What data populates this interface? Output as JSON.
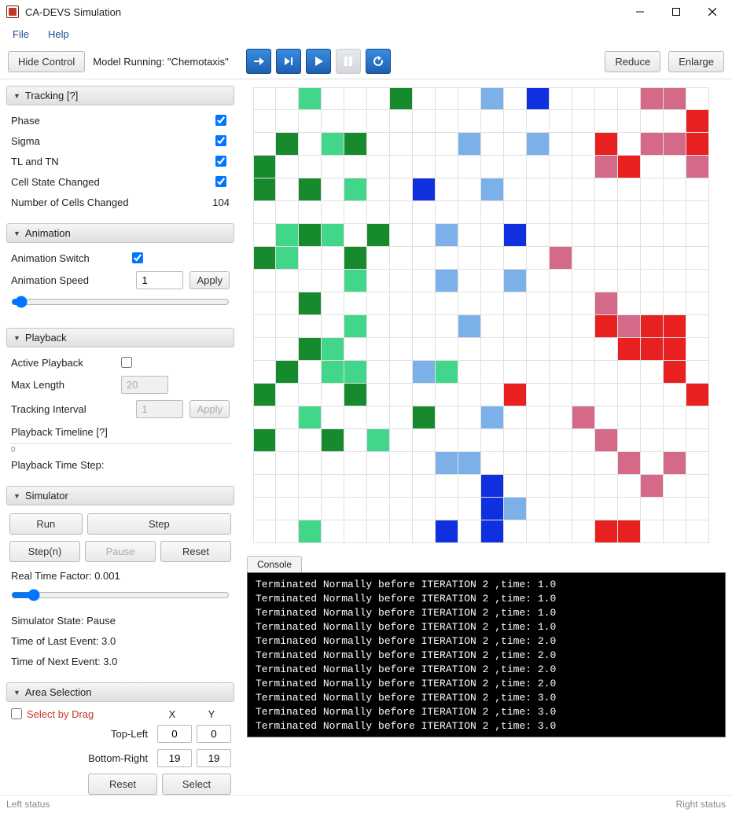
{
  "window": {
    "title": "CA-DEVS Simulation"
  },
  "menu": {
    "file": "File",
    "help": "Help"
  },
  "toolbar": {
    "hide_control": "Hide Control",
    "running_label": "Model Running: \"Chemotaxis\"",
    "reduce": "Reduce",
    "enlarge": "Enlarge"
  },
  "tracking": {
    "header": "Tracking   [?]",
    "phase": "Phase",
    "sigma": "Sigma",
    "tl_tn": "TL and TN",
    "cell_state": "Cell State Changed",
    "num_cells_label": "Number of Cells Changed",
    "num_cells_value": "104"
  },
  "animation": {
    "header": "Animation",
    "switch": "Animation Switch",
    "speed_label": "Animation Speed",
    "speed_value": "1",
    "apply": "Apply"
  },
  "playback": {
    "header": "Playback",
    "active": "Active Playback",
    "max_len_label": "Max Length",
    "max_len_value": "20",
    "track_int_label": "Tracking Interval",
    "track_int_value": "1",
    "apply": "Apply",
    "timeline_label": "Playback Timeline   [?]",
    "timeline_zero": "0",
    "timestep_label": "Playback Time Step:"
  },
  "simulator": {
    "header": "Simulator",
    "run": "Run",
    "step": "Step",
    "stepn": "Step(n)",
    "pause": "Pause",
    "reset": "Reset",
    "rtf_label": "Real Time Factor: 0.001",
    "state_label": "Simulator State: Pause",
    "last_event": "Time of Last Event: 3.0",
    "next_event": "Time of Next Event: 3.0"
  },
  "area": {
    "header": "Area Selection",
    "select_by_drag": "Select by Drag",
    "x": "X",
    "y": "Y",
    "top_left": "Top-Left",
    "bottom_right": "Bottom-Right",
    "tl_x": "0",
    "tl_y": "0",
    "br_x": "19",
    "br_y": "19",
    "reset": "Reset",
    "select": "Select"
  },
  "console": {
    "tab": "Console",
    "lines": [
      "Terminated Normally before ITERATION 2 ,time: 1.0",
      "Terminated Normally before ITERATION 2 ,time: 1.0",
      "Terminated Normally before ITERATION 2 ,time: 1.0",
      "Terminated Normally before ITERATION 2 ,time: 1.0",
      "Terminated Normally before ITERATION 2 ,time: 2.0",
      "Terminated Normally before ITERATION 2 ,time: 2.0",
      "Terminated Normally before ITERATION 2 ,time: 2.0",
      "Terminated Normally before ITERATION 2 ,time: 2.0",
      "Terminated Normally before ITERATION 2 ,time: 3.0",
      "Terminated Normally before ITERATION 2 ,time: 3.0",
      "Terminated Normally before ITERATION 2 ,time: 3.0"
    ]
  },
  "status": {
    "left": "Left status",
    "right": "Right status"
  },
  "grid": {
    "cols": 20,
    "rows": 20,
    "legend": {
      "w": "#ffffff",
      "lg": "#41d68a",
      "dg": "#178a2e",
      "lb": "#7bb0e8",
      "b": "#1030e0",
      "r": "#e82020",
      "p": "#d46a88"
    },
    "cells": [
      [
        "w",
        "w",
        "lg",
        "w",
        "w",
        "w",
        "dg",
        "w",
        "w",
        "w",
        "lb",
        "w",
        "b",
        "w",
        "w",
        "w",
        "w",
        "p",
        "p",
        "w"
      ],
      [
        "w",
        "w",
        "w",
        "w",
        "w",
        "w",
        "w",
        "w",
        "w",
        "w",
        "w",
        "w",
        "w",
        "w",
        "w",
        "w",
        "w",
        "w",
        "w",
        "r"
      ],
      [
        "w",
        "dg",
        "w",
        "lg",
        "dg",
        "w",
        "w",
        "w",
        "w",
        "lb",
        "w",
        "w",
        "lb",
        "w",
        "w",
        "r",
        "w",
        "p",
        "p",
        "r"
      ],
      [
        "dg",
        "w",
        "w",
        "w",
        "w",
        "w",
        "w",
        "w",
        "w",
        "w",
        "w",
        "w",
        "w",
        "w",
        "w",
        "p",
        "r",
        "w",
        "w",
        "p"
      ],
      [
        "dg",
        "w",
        "dg",
        "w",
        "lg",
        "w",
        "w",
        "b",
        "w",
        "w",
        "lb",
        "w",
        "w",
        "w",
        "w",
        "w",
        "w",
        "w",
        "w",
        "w"
      ],
      [
        "w",
        "w",
        "w",
        "w",
        "w",
        "w",
        "w",
        "w",
        "w",
        "w",
        "w",
        "w",
        "w",
        "w",
        "w",
        "w",
        "w",
        "w",
        "w",
        "w"
      ],
      [
        "w",
        "lg",
        "dg",
        "lg",
        "w",
        "dg",
        "w",
        "w",
        "lb",
        "w",
        "w",
        "b",
        "w",
        "w",
        "w",
        "w",
        "w",
        "w",
        "w",
        "w"
      ],
      [
        "dg",
        "lg",
        "w",
        "w",
        "dg",
        "w",
        "w",
        "w",
        "w",
        "w",
        "w",
        "w",
        "w",
        "p",
        "w",
        "w",
        "w",
        "w",
        "w",
        "w"
      ],
      [
        "w",
        "w",
        "w",
        "w",
        "lg",
        "w",
        "w",
        "w",
        "lb",
        "w",
        "w",
        "lb",
        "w",
        "w",
        "w",
        "w",
        "w",
        "w",
        "w",
        "w"
      ],
      [
        "w",
        "w",
        "dg",
        "w",
        "w",
        "w",
        "w",
        "w",
        "w",
        "w",
        "w",
        "w",
        "w",
        "w",
        "w",
        "p",
        "w",
        "w",
        "w",
        "w"
      ],
      [
        "w",
        "w",
        "w",
        "w",
        "lg",
        "w",
        "w",
        "w",
        "w",
        "lb",
        "w",
        "w",
        "w",
        "w",
        "w",
        "r",
        "p",
        "r",
        "r",
        "w"
      ],
      [
        "w",
        "w",
        "dg",
        "lg",
        "w",
        "w",
        "w",
        "w",
        "w",
        "w",
        "w",
        "w",
        "w",
        "w",
        "w",
        "w",
        "r",
        "r",
        "r",
        "w"
      ],
      [
        "w",
        "dg",
        "w",
        "lg",
        "lg",
        "w",
        "w",
        "lb",
        "lg",
        "w",
        "w",
        "w",
        "w",
        "w",
        "w",
        "w",
        "w",
        "w",
        "r",
        "w"
      ],
      [
        "dg",
        "w",
        "w",
        "w",
        "dg",
        "w",
        "w",
        "w",
        "w",
        "w",
        "w",
        "r",
        "w",
        "w",
        "w",
        "w",
        "w",
        "w",
        "w",
        "r"
      ],
      [
        "w",
        "w",
        "lg",
        "w",
        "w",
        "w",
        "w",
        "dg",
        "w",
        "w",
        "lb",
        "w",
        "w",
        "w",
        "p",
        "w",
        "w",
        "w",
        "w",
        "w"
      ],
      [
        "dg",
        "w",
        "w",
        "dg",
        "w",
        "lg",
        "w",
        "w",
        "w",
        "w",
        "w",
        "w",
        "w",
        "w",
        "w",
        "p",
        "w",
        "w",
        "w",
        "w"
      ],
      [
        "w",
        "w",
        "w",
        "w",
        "w",
        "w",
        "w",
        "w",
        "lb",
        "lb",
        "w",
        "w",
        "w",
        "w",
        "w",
        "w",
        "p",
        "w",
        "p",
        "w"
      ],
      [
        "w",
        "w",
        "w",
        "w",
        "w",
        "w",
        "w",
        "w",
        "w",
        "w",
        "b",
        "w",
        "w",
        "w",
        "w",
        "w",
        "w",
        "p",
        "w",
        "w"
      ],
      [
        "w",
        "w",
        "w",
        "w",
        "w",
        "w",
        "w",
        "w",
        "w",
        "w",
        "b",
        "lb",
        "w",
        "w",
        "w",
        "w",
        "w",
        "w",
        "w",
        "w"
      ],
      [
        "w",
        "w",
        "lg",
        "w",
        "w",
        "w",
        "w",
        "w",
        "b",
        "w",
        "b",
        "w",
        "w",
        "w",
        "w",
        "r",
        "r",
        "w",
        "w",
        "w"
      ]
    ]
  }
}
